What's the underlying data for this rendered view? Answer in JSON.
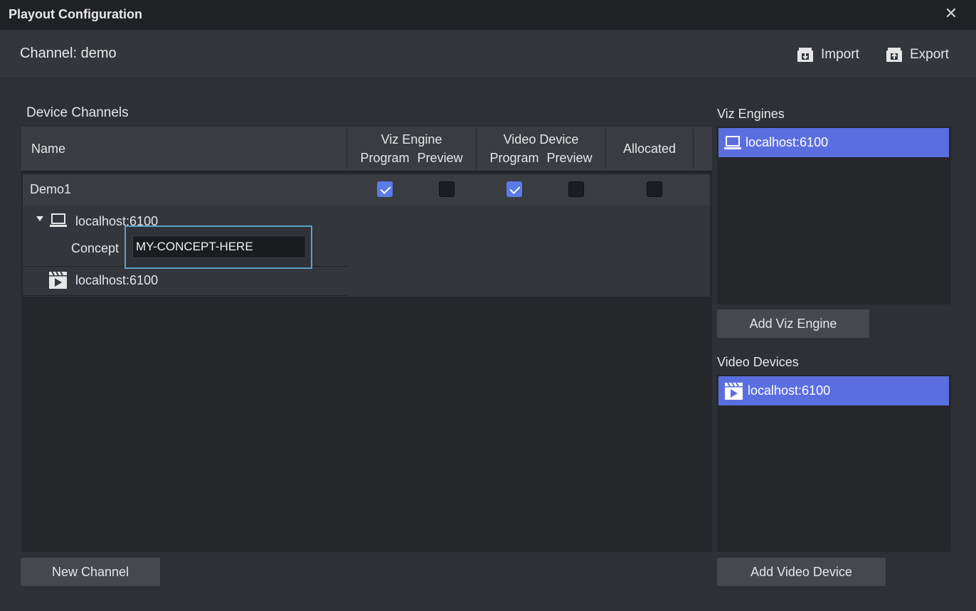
{
  "window": {
    "title": "Playout Configuration",
    "close_glyph": "✕"
  },
  "header": {
    "channel_label": "Channel: demo",
    "import_label": "Import",
    "export_label": "Export"
  },
  "device_channels": {
    "label": "Device Channels",
    "columns": {
      "name": "Name",
      "viz_engine": "Viz Engine",
      "video_device": "Video Device",
      "program": "Program",
      "preview": "Preview",
      "allocated": "Allocated"
    },
    "rows": [
      {
        "name": "Demo1",
        "viz_program": true,
        "viz_preview": false,
        "video_program": true,
        "video_preview": false,
        "allocated": false,
        "children": [
          {
            "icon": "monitor-icon",
            "name": "localhost:6100",
            "concept_label": "Concept",
            "concept_value": "MY-CONCEPT-HERE"
          },
          {
            "icon": "video-clip-icon",
            "name": "localhost:6100"
          }
        ]
      }
    ],
    "new_channel_label": "New Channel"
  },
  "viz_engines": {
    "label": "Viz Engines",
    "items": [
      {
        "icon": "monitor-icon",
        "name": "localhost:6100"
      }
    ],
    "add_label": "Add Viz Engine"
  },
  "video_devices": {
    "label": "Video Devices",
    "items": [
      {
        "icon": "video-clip-icon",
        "name": "localhost:6100"
      }
    ],
    "add_label": "Add Video Device"
  },
  "colors": {
    "accent": "#5b6ee0",
    "checkbox_on": "#5b7be6",
    "focus_border": "#5b9fc8"
  }
}
